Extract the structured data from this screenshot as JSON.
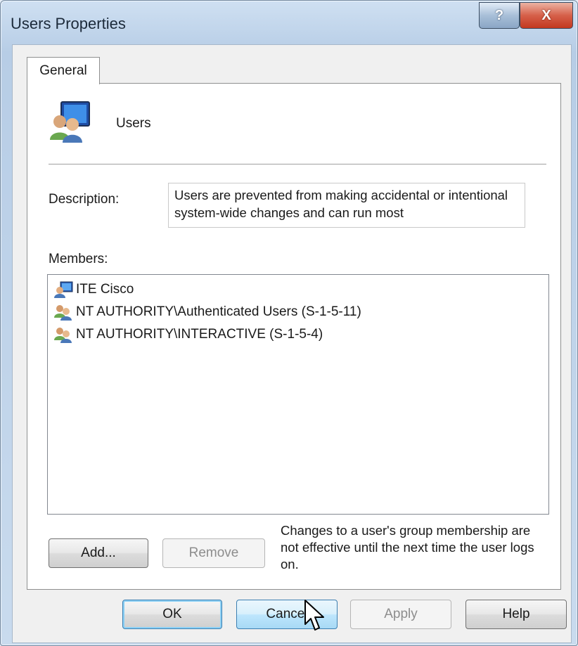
{
  "window": {
    "title": "Users Properties"
  },
  "titlebar": {
    "help_glyph": "?",
    "close_glyph": "X"
  },
  "tabs": [
    {
      "label": "General"
    }
  ],
  "group": {
    "name": "Users",
    "icon": "users-group-icon"
  },
  "description": {
    "label": "Description:",
    "value": "Users are prevented from making accidental or intentional system-wide changes and can run most"
  },
  "members": {
    "label": "Members:",
    "items": [
      {
        "name": "ITE Cisco",
        "icon": "user-computer-icon"
      },
      {
        "name": "NT AUTHORITY\\Authenticated Users (S-1-5-11)",
        "icon": "group-icon"
      },
      {
        "name": "NT AUTHORITY\\INTERACTIVE (S-1-5-4)",
        "icon": "group-icon"
      }
    ]
  },
  "buttons": {
    "add": "Add...",
    "remove": "Remove",
    "ok": "OK",
    "cancel": "Cancel",
    "apply": "Apply",
    "help": "Help"
  },
  "note": "Changes to a user's group membership are not effective until the next time the user logs on.",
  "colors": {
    "titlebar": "#c9dbee",
    "close_button": "#c2381f",
    "focus_ring": "#8bd0f5"
  }
}
